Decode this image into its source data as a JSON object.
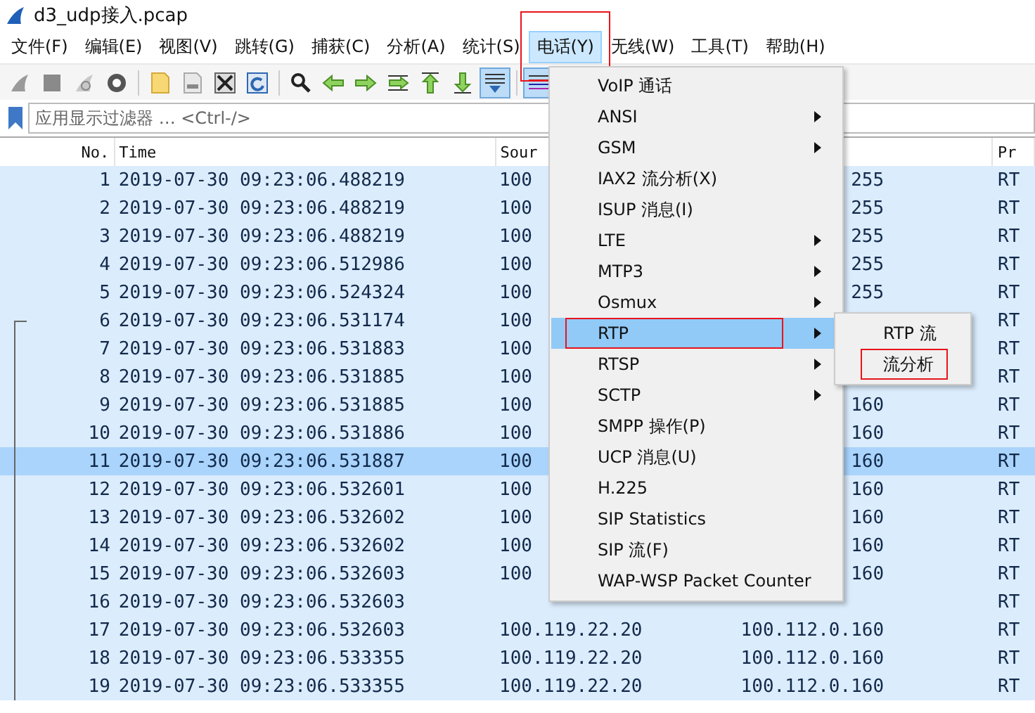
{
  "window": {
    "title": "d3_udp接入.pcap"
  },
  "menubar": [
    {
      "label": "文件(F)",
      "selected": false,
      "highlighted": false
    },
    {
      "label": "编辑(E)",
      "selected": false,
      "highlighted": false
    },
    {
      "label": "视图(V)",
      "selected": false,
      "highlighted": false
    },
    {
      "label": "跳转(G)",
      "selected": false,
      "highlighted": false
    },
    {
      "label": "捕获(C)",
      "selected": false,
      "highlighted": false
    },
    {
      "label": "分析(A)",
      "selected": false,
      "highlighted": false
    },
    {
      "label": "统计(S)",
      "selected": false,
      "highlighted": false
    },
    {
      "label": "电话(Y)",
      "selected": true,
      "highlighted": true
    },
    {
      "label": "无线(W)",
      "selected": false,
      "highlighted": false
    },
    {
      "label": "工具(T)",
      "selected": false,
      "highlighted": false
    },
    {
      "label": "帮助(H)",
      "selected": false,
      "highlighted": false
    }
  ],
  "toolbar": [
    {
      "kind": "fin",
      "pressed": false
    },
    {
      "kind": "stop",
      "pressed": false
    },
    {
      "kind": "restart",
      "pressed": false
    },
    {
      "kind": "options",
      "pressed": false
    },
    {
      "kind": "sep"
    },
    {
      "kind": "open",
      "pressed": false
    },
    {
      "kind": "save",
      "pressed": false
    },
    {
      "kind": "close",
      "pressed": false
    },
    {
      "kind": "reload",
      "pressed": false
    },
    {
      "kind": "sep"
    },
    {
      "kind": "find",
      "pressed": false
    },
    {
      "kind": "back",
      "pressed": false
    },
    {
      "kind": "forward",
      "pressed": false
    },
    {
      "kind": "goto",
      "pressed": false
    },
    {
      "kind": "first",
      "pressed": false
    },
    {
      "kind": "last",
      "pressed": false
    },
    {
      "kind": "autoscroll",
      "pressed": true
    },
    {
      "kind": "sep"
    },
    {
      "kind": "colorize",
      "pressed": true
    }
  ],
  "filter": {
    "placeholder": "应用显示过滤器 … <Ctrl-/>"
  },
  "table": {
    "columns": [
      "No.",
      "Time",
      "Sour",
      "",
      "Pr"
    ],
    "rows": [
      {
        "no": "1",
        "time": "2019-07-30 09:23:06.488219",
        "source": "100",
        "destination": "255",
        "protocol": "RT",
        "selected": false,
        "related": false
      },
      {
        "no": "2",
        "time": "2019-07-30 09:23:06.488219",
        "source": "100",
        "destination": "255",
        "protocol": "RT",
        "selected": false,
        "related": false
      },
      {
        "no": "3",
        "time": "2019-07-30 09:23:06.488219",
        "source": "100",
        "destination": "255",
        "protocol": "RT",
        "selected": false,
        "related": false
      },
      {
        "no": "4",
        "time": "2019-07-30 09:23:06.512986",
        "source": "100",
        "destination": "255",
        "protocol": "RT",
        "selected": false,
        "related": false
      },
      {
        "no": "5",
        "time": "2019-07-30 09:23:06.524324",
        "source": "100",
        "destination": "255",
        "protocol": "RT",
        "selected": false,
        "related": false
      },
      {
        "no": "6",
        "time": "2019-07-30 09:23:06.531174",
        "source": "100",
        "protocol": "RT",
        "selected": false,
        "related": true
      },
      {
        "no": "7",
        "time": "2019-07-30 09:23:06.531883",
        "source": "100",
        "protocol": "RT",
        "selected": false,
        "related": true
      },
      {
        "no": "8",
        "time": "2019-07-30 09:23:06.531885",
        "source": "100",
        "protocol": "RT",
        "selected": false,
        "related": true
      },
      {
        "no": "9",
        "time": "2019-07-30 09:23:06.531885",
        "source": "100",
        "destination": "160",
        "protocol": "RT",
        "selected": false,
        "related": true
      },
      {
        "no": "10",
        "time": "2019-07-30 09:23:06.531886",
        "source": "100",
        "destination": "160",
        "protocol": "RT",
        "selected": false,
        "related": true
      },
      {
        "no": "11",
        "time": "2019-07-30 09:23:06.531887",
        "source": "100",
        "destination": "160",
        "protocol": "RT",
        "selected": true,
        "related": true
      },
      {
        "no": "12",
        "time": "2019-07-30 09:23:06.532601",
        "source": "100",
        "destination": "160",
        "protocol": "RT",
        "selected": false,
        "related": true
      },
      {
        "no": "13",
        "time": "2019-07-30 09:23:06.532602",
        "source": "100",
        "destination": "160",
        "protocol": "RT",
        "selected": false,
        "related": true
      },
      {
        "no": "14",
        "time": "2019-07-30 09:23:06.532602",
        "source": "100",
        "destination": "160",
        "protocol": "RT",
        "selected": false,
        "related": true
      },
      {
        "no": "15",
        "time": "2019-07-30 09:23:06.532603",
        "source": "100",
        "destination": "160",
        "protocol": "RT",
        "selected": false,
        "related": true
      },
      {
        "no": "16",
        "time": "2019-07-30 09:23:06.532603",
        "protocol": "RT",
        "selected": false,
        "related": true
      },
      {
        "no": "17",
        "time": "2019-07-30 09:23:06.532603",
        "source": "100.119.22.20",
        "destination": "100.112.0.160",
        "protocol": "RT",
        "selected": false,
        "related": true
      },
      {
        "no": "18",
        "time": "2019-07-30 09:23:06.533355",
        "source": "100.119.22.20",
        "destination": "100.112.0.160",
        "protocol": "RT",
        "selected": false,
        "related": true
      },
      {
        "no": "19",
        "time": "2019-07-30 09:23:06.533355",
        "source": "100.119.22.20",
        "destination": "100.112.0.160",
        "protocol": "RT",
        "selected": false,
        "related": true
      }
    ]
  },
  "menu": {
    "items": [
      {
        "label": "VoIP 通话",
        "submenu": false,
        "selected": false,
        "highlighted": false
      },
      {
        "label": "ANSI",
        "submenu": true,
        "selected": false,
        "highlighted": false
      },
      {
        "label": "GSM",
        "submenu": true,
        "selected": false,
        "highlighted": false
      },
      {
        "label": "IAX2 流分析(X)",
        "submenu": false,
        "selected": false,
        "highlighted": false
      },
      {
        "label": "ISUP 消息(I)",
        "submenu": false,
        "selected": false,
        "highlighted": false
      },
      {
        "label": "LTE",
        "submenu": true,
        "selected": false,
        "highlighted": false
      },
      {
        "label": "MTP3",
        "submenu": true,
        "selected": false,
        "highlighted": false
      },
      {
        "label": "Osmux",
        "submenu": true,
        "selected": false,
        "highlighted": false
      },
      {
        "label": "RTP",
        "submenu": true,
        "selected": true,
        "highlighted": true
      },
      {
        "label": "RTSP",
        "submenu": true,
        "selected": false,
        "highlighted": false
      },
      {
        "label": "SCTP",
        "submenu": true,
        "selected": false,
        "highlighted": false
      },
      {
        "label": "SMPP 操作(P)",
        "submenu": false,
        "selected": false,
        "highlighted": false
      },
      {
        "label": "UCP 消息(U)",
        "submenu": false,
        "selected": false,
        "highlighted": false
      },
      {
        "label": "H.225",
        "submenu": false,
        "selected": false,
        "highlighted": false
      },
      {
        "label": "SIP Statistics",
        "submenu": false,
        "selected": false,
        "highlighted": false
      },
      {
        "label": "SIP 流(F)",
        "submenu": false,
        "selected": false,
        "highlighted": false
      },
      {
        "label": "WAP-WSP Packet Counter",
        "submenu": false,
        "selected": false,
        "highlighted": false
      }
    ],
    "submenu": [
      {
        "label": "RTP 流",
        "selected": false,
        "highlighted": false
      },
      {
        "label": "流分析",
        "selected": false,
        "highlighted": true
      }
    ]
  }
}
